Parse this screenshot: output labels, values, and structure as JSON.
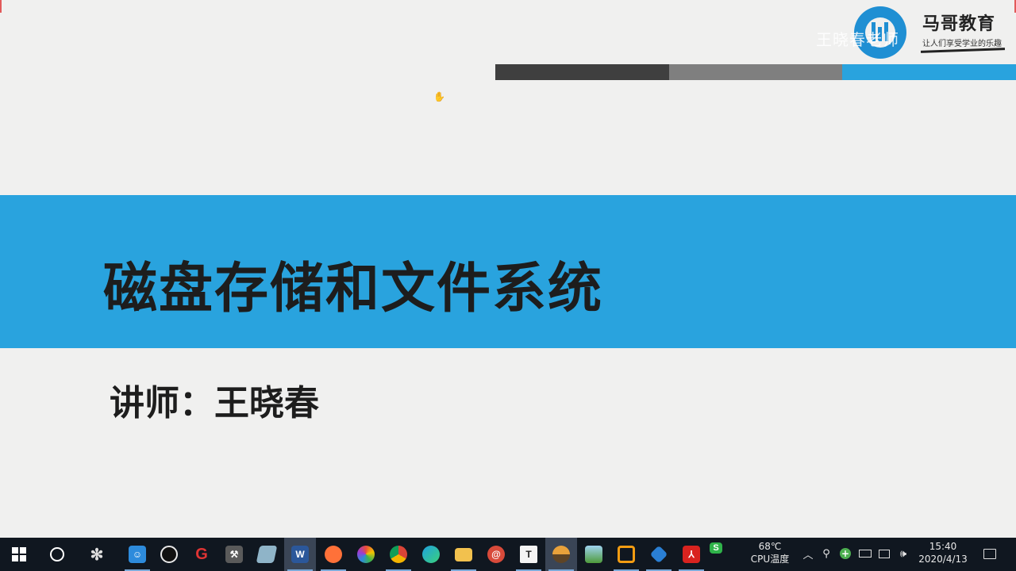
{
  "slide": {
    "title": "磁盘存储和文件系统",
    "lecturer": "讲师：王晓春",
    "logo": {
      "name": "马哥教育",
      "slogan": "让人们享受学业的乐趣"
    },
    "watermark": "王晓春老师",
    "colors": {
      "band": "#29a3de",
      "strip_dark": "#3f3f3f",
      "strip_mid": "#7f7f7f",
      "strip_blue": "#29a3de",
      "background": "#f0f0ef"
    }
  },
  "taskbar": {
    "apps": [
      {
        "name": "start",
        "icon": "windows-logo-icon"
      },
      {
        "name": "cortana",
        "icon": "cortana-circle-icon"
      },
      {
        "name": "pinwheel",
        "icon": "pinwheel-icon"
      },
      {
        "name": "contacts",
        "icon": "contacts-app-icon"
      },
      {
        "name": "qq",
        "icon": "qq-penguin-icon"
      },
      {
        "name": "g-app",
        "icon": "g-app-icon"
      },
      {
        "name": "tools",
        "icon": "tools-app-icon"
      },
      {
        "name": "notes",
        "icon": "notes-app-icon"
      },
      {
        "name": "word",
        "icon": "word-app-icon",
        "glyph": "W"
      },
      {
        "name": "firefox",
        "icon": "firefox-icon"
      },
      {
        "name": "color-app",
        "icon": "color-wheel-icon"
      },
      {
        "name": "chrome",
        "icon": "chrome-icon"
      },
      {
        "name": "edge",
        "icon": "edge-icon"
      },
      {
        "name": "file-explorer",
        "icon": "folder-icon"
      },
      {
        "name": "snail-app",
        "icon": "snail-app-icon"
      },
      {
        "name": "typora",
        "icon": "typora-icon",
        "glyph": "T"
      },
      {
        "name": "landscape-app",
        "icon": "landscape-app-icon"
      },
      {
        "name": "image-viewer",
        "icon": "image-viewer-icon"
      },
      {
        "name": "vmware",
        "icon": "vmware-icon"
      },
      {
        "name": "cube-app",
        "icon": "cube-app-icon"
      },
      {
        "name": "acrobat",
        "icon": "acrobat-icon"
      },
      {
        "name": "wps",
        "icon": "wps-icon",
        "glyph": "S"
      }
    ],
    "tray": {
      "temperature": "68℃",
      "temperature_label": "CPU温度",
      "time": "15:40",
      "date": "2020/4/13"
    }
  }
}
